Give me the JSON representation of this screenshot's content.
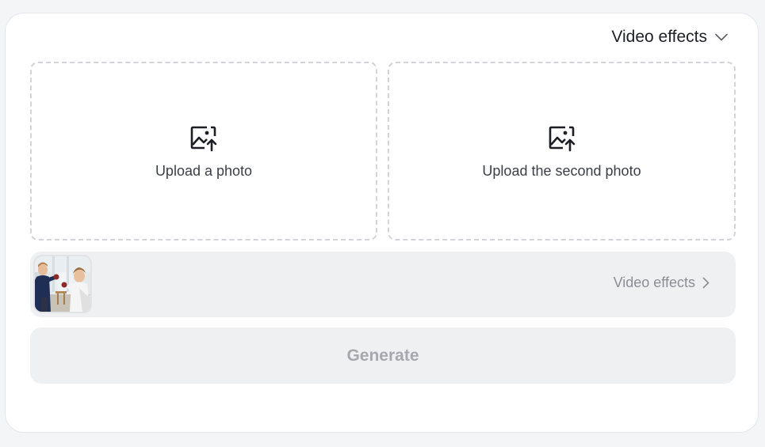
{
  "header": {
    "mode_label": "Video effects",
    "mode_icon": "chevron-down-icon"
  },
  "uploads": [
    {
      "label": "Upload a photo",
      "icon": "image-upload-icon"
    },
    {
      "label": "Upload the second photo",
      "icon": "image-upload-icon"
    }
  ],
  "effects": {
    "thumbnail": "video-effect-preview",
    "link_label": "Video effects",
    "link_icon": "chevron-right-icon"
  },
  "actions": {
    "generate_label": "Generate",
    "generate_disabled": true
  },
  "colors": {
    "page_background": "#f4f5f7",
    "card_background": "#ffffff",
    "dashed_border": "#d2d4d8",
    "panel_background": "#eff0f2",
    "muted_text": "#8a8d93",
    "disabled_text": "#a6a8ad"
  }
}
